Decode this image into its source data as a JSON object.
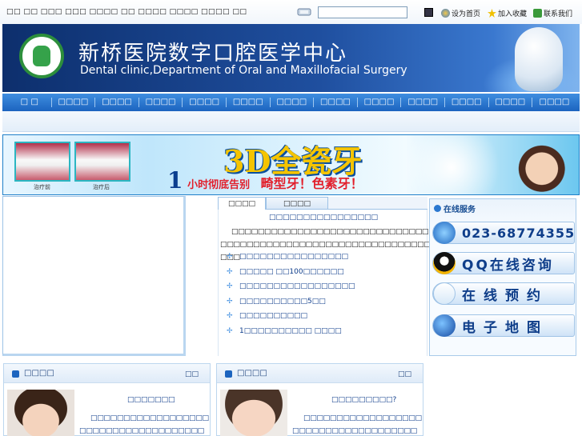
{
  "topbar": {
    "links": "□□ □□ □□□ □□□ □□□□ □□ □□□□ □□□□ □□□□ □□",
    "search_value": "",
    "set_home": "设为首页",
    "add_favorite": "加入收藏",
    "contact": "联系我们"
  },
  "banner": {
    "title_cn": "新桥医院数字口腔医学中心",
    "title_en": "Dental clinic,Department of Oral and Maxillofacial Surgery"
  },
  "nav": {
    "items": [
      "□ □",
      "□□□□",
      "□□□□",
      "□□□□",
      "□□□□",
      "□□□□",
      "□□□□",
      "□□□□",
      "□□□□",
      "□□□□",
      "□□□□",
      "□□□□",
      "□□□□"
    ]
  },
  "promo": {
    "title": "3D全瓷牙",
    "before": "治疗前",
    "after": "治疗后",
    "hour": "1",
    "line1": "小时彻底告别",
    "line2": "畸型牙！色素牙！"
  },
  "tabs": {
    "active": "□□□□",
    "inactive": "□□□□"
  },
  "news": {
    "headline": "□□□□□□□□□□□□□□□□",
    "summary": "□□□□□□□□□□□□□□□□□□□□□□□□□□□□□□□□□□□□□□□□□□□□□□□□□□□□□□□□□□□□□□□□□□□□□□",
    "items": [
      "□□□□□□□□□□□□□□□□",
      "□□□□□ □□100□□□□□□",
      "□□□□□□□□□□□□□□□□□",
      "□□□□□□□□□□5□□",
      "□□□□□□□□□□",
      "1□□□□□□□□□□ □□□□"
    ]
  },
  "service": {
    "title": "在线服务",
    "phone": "023-68774355",
    "qq": "QQ在线咨询",
    "booking": "在线预约",
    "map": "电子地图"
  },
  "panels": [
    {
      "title": "□□□□",
      "more": "□□",
      "name": "□□□□□□□",
      "text": "□□□□□□□□□□□□□□□□□□□□□□□□□□□□□□□□□□□□□□□□□□□□□□□□□□□□"
    },
    {
      "title": "□□□□",
      "more": "□□",
      "name": "□□□□□□□□□?",
      "text": "□□□□□□□□□□□□□□□□□□□□□□□□□□□□□□□□□□□□□□□□□□□□□□□□□□□□"
    }
  ],
  "colors": {
    "nav_blue": "#1c64bf",
    "link_blue": "#0c3b8a",
    "promo_red": "#e21f2b",
    "promo_gold": "#f5c400"
  }
}
